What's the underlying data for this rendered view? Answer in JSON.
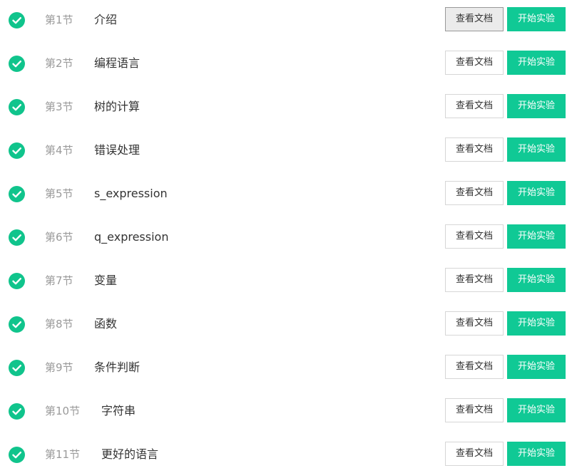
{
  "colors": {
    "accent": "#10c995",
    "check": "#10c48c",
    "muted_text": "#9a9a9a",
    "title_text": "#333333"
  },
  "labels": {
    "view_doc": "查看文档",
    "start_lab": "开始实验"
  },
  "lessons": [
    {
      "number": "第1节",
      "title": "介绍",
      "completed": true
    },
    {
      "number": "第2节",
      "title": "编程语言",
      "completed": true
    },
    {
      "number": "第3节",
      "title": "树的计算",
      "completed": true
    },
    {
      "number": "第4节",
      "title": "错误处理",
      "completed": true
    },
    {
      "number": "第5节",
      "title": "s_expression",
      "completed": true
    },
    {
      "number": "第6节",
      "title": "q_expression",
      "completed": true
    },
    {
      "number": "第7节",
      "title": "变量",
      "completed": true
    },
    {
      "number": "第8节",
      "title": "函数",
      "completed": true
    },
    {
      "number": "第9节",
      "title": "条件判断",
      "completed": true
    },
    {
      "number": "第10节",
      "title": "字符串",
      "completed": true
    },
    {
      "number": "第11节",
      "title": "更好的语言",
      "completed": true
    }
  ]
}
